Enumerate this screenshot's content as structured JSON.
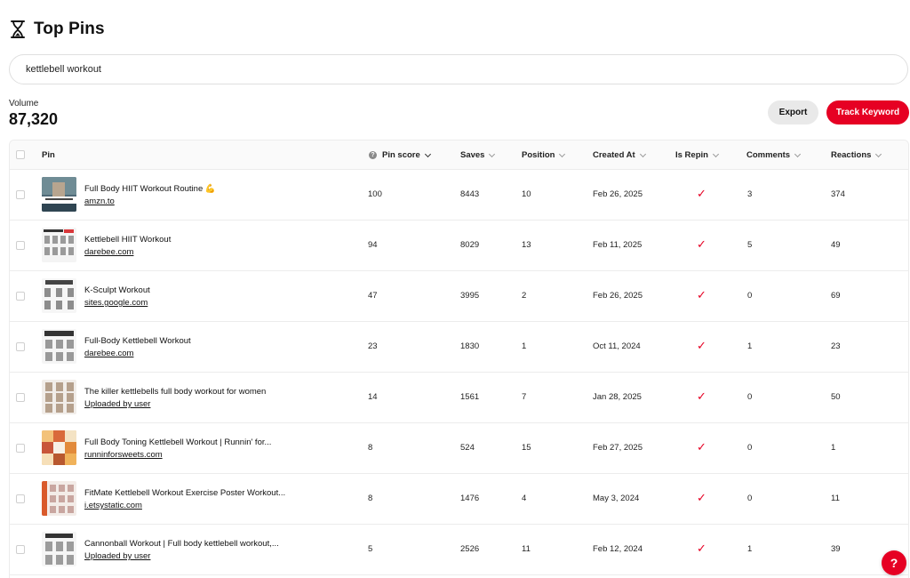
{
  "header": {
    "title": "Top Pins",
    "icon": "hourglass-icon"
  },
  "search": {
    "value": "kettlebell workout"
  },
  "volume": {
    "label": "Volume",
    "value": "87,320"
  },
  "actions": {
    "export_label": "Export",
    "track_label": "Track Keyword",
    "accent": "#e60023"
  },
  "table": {
    "columns": {
      "pin": "Pin",
      "pin_score": "Pin score",
      "saves": "Saves",
      "position": "Position",
      "created_at": "Created At",
      "is_repin": "Is Repin",
      "comments": "Comments",
      "reactions": "Reactions"
    },
    "rows": [
      {
        "title": "Full Body HIIT Workout Routine 💪",
        "source": "amzn.to",
        "pin_score": "100",
        "saves": "8443",
        "position": "10",
        "created_at": "Feb 26, 2025",
        "is_repin": "✓",
        "comments": "3",
        "reactions": "374"
      },
      {
        "title": "Kettlebell HIIT Workout",
        "source": "darebee.com",
        "pin_score": "94",
        "saves": "8029",
        "position": "13",
        "created_at": "Feb 11, 2025",
        "is_repin": "✓",
        "comments": "5",
        "reactions": "49"
      },
      {
        "title": "K-Sculpt Workout",
        "source": "sites.google.com",
        "pin_score": "47",
        "saves": "3995",
        "position": "2",
        "created_at": "Feb 26, 2025",
        "is_repin": "✓",
        "comments": "0",
        "reactions": "69"
      },
      {
        "title": "Full-Body Kettlebell Workout",
        "source": "darebee.com",
        "pin_score": "23",
        "saves": "1830",
        "position": "1",
        "created_at": "Oct 11, 2024",
        "is_repin": "✓",
        "comments": "1",
        "reactions": "23"
      },
      {
        "title": "The killer kettlebells full body workout for women",
        "source": "Uploaded by user",
        "pin_score": "14",
        "saves": "1561",
        "position": "7",
        "created_at": "Jan 28, 2025",
        "is_repin": "✓",
        "comments": "0",
        "reactions": "50"
      },
      {
        "title": "Full Body Toning Kettlebell Workout | Runnin' for...",
        "source": "runninforsweets.com",
        "pin_score": "8",
        "saves": "524",
        "position": "15",
        "created_at": "Feb 27, 2025",
        "is_repin": "✓",
        "comments": "0",
        "reactions": "1"
      },
      {
        "title": "FitMate Kettlebell Workout Exercise Poster Workout...",
        "source": "i.etsystatic.com",
        "pin_score": "8",
        "saves": "1476",
        "position": "4",
        "created_at": "May 3, 2024",
        "is_repin": "✓",
        "comments": "0",
        "reactions": "11"
      },
      {
        "title": "Cannonball Workout | Full body kettlebell workout,...",
        "source": "Uploaded by user",
        "pin_score": "5",
        "saves": "2526",
        "position": "11",
        "created_at": "Feb 12, 2024",
        "is_repin": "✓",
        "comments": "1",
        "reactions": "39"
      }
    ]
  },
  "help": {
    "label": "?"
  }
}
